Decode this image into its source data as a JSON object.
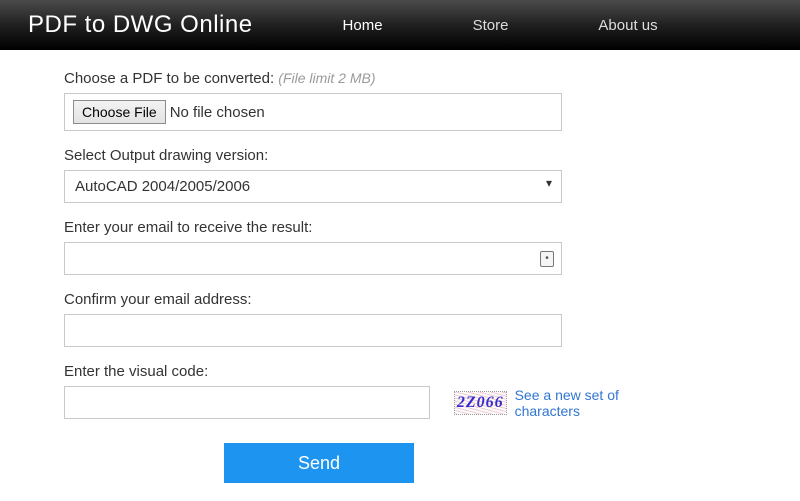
{
  "header": {
    "brand": "PDF to DWG Online",
    "nav": {
      "home": "Home",
      "store": "Store",
      "about": "About us"
    }
  },
  "form": {
    "file": {
      "label": "Choose a PDF to be converted:",
      "hint": "(File limit 2 MB)",
      "button": "Choose File",
      "status": "No file chosen"
    },
    "version": {
      "label": "Select Output drawing version:",
      "selected": "AutoCAD 2004/2005/2006"
    },
    "email": {
      "label": "Enter your email to receive the result:",
      "value": ""
    },
    "confirm": {
      "label": "Confirm your email address:",
      "value": ""
    },
    "captcha": {
      "label": "Enter the visual code:",
      "image_text": "2Z066",
      "link": "See a new set of characters",
      "value": ""
    },
    "submit": "Send"
  }
}
